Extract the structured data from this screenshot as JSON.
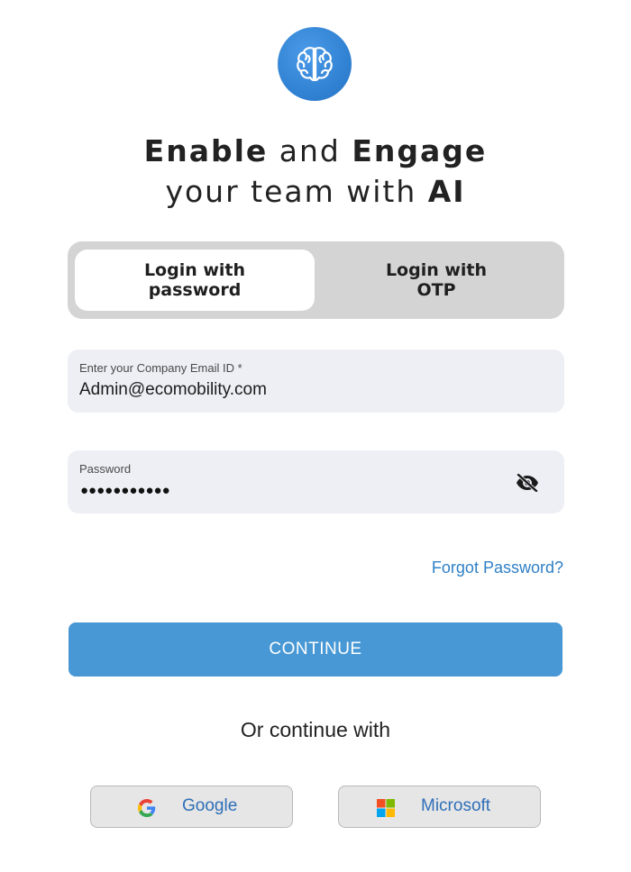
{
  "brand": {
    "logo_icon": "brain-icon",
    "logo_color": "#2f7fd1"
  },
  "headline": {
    "line1_bold_a": "Enable",
    "line1_light": " and ",
    "line1_bold_b": "Engage",
    "line2_light": "your team with ",
    "line2_bold": "AI"
  },
  "tabs": [
    {
      "line1": "Login with",
      "line2": "password",
      "active": true
    },
    {
      "line1": "Login with",
      "line2": "OTP",
      "active": false
    }
  ],
  "form": {
    "email_label": "Enter your Company Email ID *",
    "email_value": "Admin@ecomobility.com",
    "password_label": "Password",
    "password_value": "●●●●●●●●●●●",
    "password_toggle_icon": "eye-slash-icon"
  },
  "links": {
    "forgot_password": "Forgot Password?"
  },
  "buttons": {
    "continue": "CONTINUE"
  },
  "social": {
    "or_text": "Or continue with",
    "google": "Google",
    "microsoft": "Microsoft"
  },
  "colors": {
    "primary": "#4798d5",
    "link": "#2f80c6",
    "field_bg": "#eeeff5",
    "tab_bg": "#d4d4d4"
  }
}
